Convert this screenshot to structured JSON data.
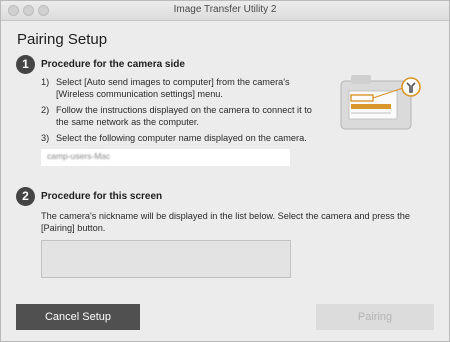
{
  "window": {
    "title": "Image Transfer Utility 2"
  },
  "page": {
    "heading": "Pairing Setup"
  },
  "step1": {
    "number": "1",
    "title": "Procedure for the camera side",
    "items": [
      {
        "num": "1)",
        "text": "Select [Auto send images to computer] from the camera's [Wireless communication settings] menu."
      },
      {
        "num": "2)",
        "text": "Follow the instructions displayed on the camera to connect it to the same network as the computer."
      },
      {
        "num": "3)",
        "text": "Select the following computer name displayed on the camera."
      }
    ],
    "computer_name": "camp-users-Mac"
  },
  "step2": {
    "number": "2",
    "title": "Procedure for this screen",
    "description": "The camera's nickname will be displayed in the list below. Select the camera and press the [Pairing] button."
  },
  "buttons": {
    "cancel": "Cancel Setup",
    "pairing": "Pairing"
  },
  "colors": {
    "accent_orange": "#d9962b",
    "button_dark": "#505050",
    "step_circle": "#444444"
  },
  "icons": {
    "illustration": "camera-wrench-illustration"
  }
}
